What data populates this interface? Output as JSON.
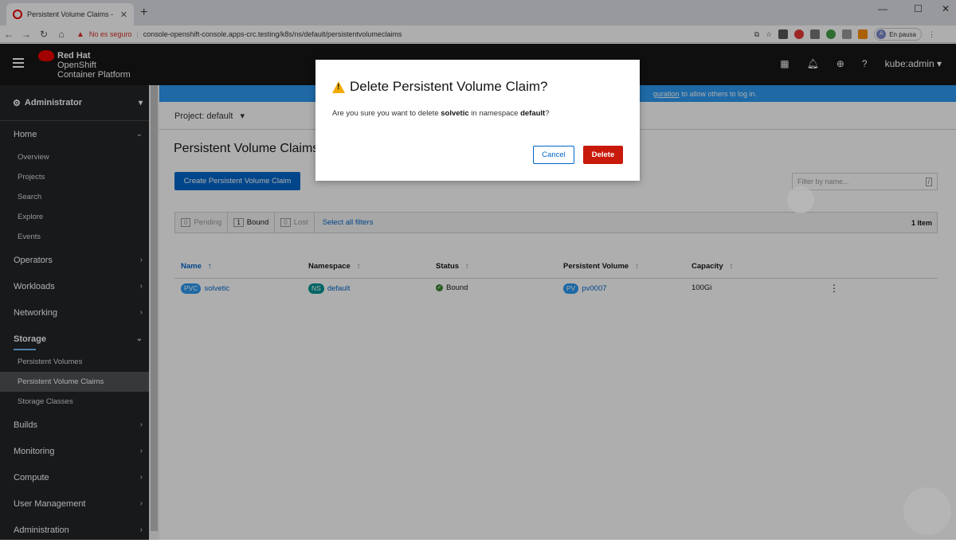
{
  "browser": {
    "tab_title": "Persistent Volume Claims - Red H",
    "tab_close": "✕",
    "new_tab": "+",
    "security_label": "No es seguro",
    "separator": "|",
    "url": "console-openshift-console.apps-crc.testing/k8s/ns/default/persistentvolumeclaims",
    "profile_initial": "A",
    "profile_label": "En pausa",
    "win_min": "—",
    "win_max": "☐",
    "win_close": "✕"
  },
  "masthead": {
    "brand_line1": "Red Hat",
    "brand_line2": "OpenShift",
    "brand_line3": "Container Platform",
    "user": "kube:admin"
  },
  "sidebar": {
    "perspective": "Administrator",
    "groups": [
      {
        "label": "Home"
      },
      {
        "label": "Operators"
      },
      {
        "label": "Workloads"
      },
      {
        "label": "Networking"
      },
      {
        "label": "Storage"
      },
      {
        "label": "Builds"
      },
      {
        "label": "Monitoring"
      },
      {
        "label": "Compute"
      },
      {
        "label": "User Management"
      },
      {
        "label": "Administration"
      }
    ],
    "home_items": [
      "Overview",
      "Projects",
      "Search",
      "Explore",
      "Events"
    ],
    "storage_items": [
      "Persistent Volumes",
      "Persistent Volume Claims",
      "Storage Classes"
    ]
  },
  "banner": {
    "link": "guration",
    "text": "to allow others to log in."
  },
  "project": {
    "label": "Project: default"
  },
  "page": {
    "title": "Persistent Volume Claims",
    "create_button": "Create Persistent Volume Claim",
    "filter_placeholder": "Filter by name...",
    "filter_shortcut": "/"
  },
  "row_filter": {
    "chips": [
      {
        "count": "0",
        "label": "Pending"
      },
      {
        "count": "1",
        "label": "Bound"
      },
      {
        "count": "0",
        "label": "Lost"
      }
    ],
    "select_all": "Select all filters",
    "total": "1 Item"
  },
  "table": {
    "headers": [
      "Name",
      "Namespace",
      "Status",
      "Persistent Volume",
      "Capacity"
    ],
    "rows": [
      {
        "name_badge": "PVC",
        "name": "solvetic",
        "ns_badge": "NS",
        "namespace": "default",
        "status": "Bound",
        "pv_badge": "PV",
        "pv": "pv0007",
        "capacity": "100Gi"
      }
    ]
  },
  "modal": {
    "title": "Delete Persistent Volume Claim?",
    "body_prefix": "Are you sure you want to delete",
    "body_name": "solvetic",
    "body_mid": "in namespace",
    "body_ns": "default",
    "body_suffix": "?",
    "cancel": "Cancel",
    "delete": "Delete"
  },
  "colors": {
    "masthead": "#151515",
    "sidebar": "#212427",
    "primary": "#0066cc",
    "danger": "#c9190b",
    "warning": "#f0ab00",
    "banner": "#2b9af3"
  }
}
